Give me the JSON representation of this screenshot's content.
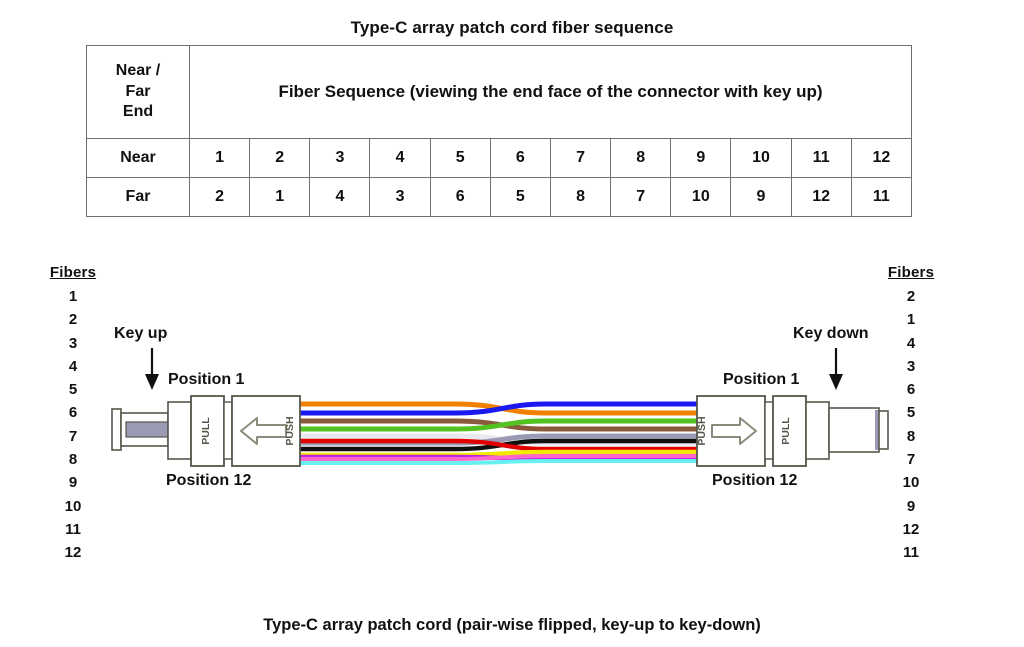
{
  "title": "Type-C array patch cord fiber sequence",
  "caption": "Type-C array patch cord (pair-wise flipped, key-up to key-down)",
  "table": {
    "header_end": "Near /\nFar\nEnd",
    "header_end_line1": "Near /",
    "header_end_line2": "Far",
    "header_end_line3": "End",
    "header_sequence": "Fiber Sequence (viewing the end face of the connector with key up)",
    "rows": [
      {
        "label": "Near",
        "values": [
          "1",
          "2",
          "3",
          "4",
          "5",
          "6",
          "7",
          "8",
          "9",
          "10",
          "11",
          "12"
        ]
      },
      {
        "label": "Far",
        "values": [
          "2",
          "1",
          "4",
          "3",
          "6",
          "5",
          "8",
          "7",
          "10",
          "9",
          "12",
          "11"
        ]
      }
    ]
  },
  "left_fibers": {
    "heading": "Fibers",
    "numbers": [
      "1",
      "2",
      "3",
      "4",
      "5",
      "6",
      "7",
      "8",
      "9",
      "10",
      "11",
      "12"
    ]
  },
  "right_fibers": {
    "heading": "Fibers",
    "numbers": [
      "2",
      "1",
      "4",
      "3",
      "6",
      "5",
      "8",
      "7",
      "10",
      "9",
      "12",
      "11"
    ]
  },
  "diagram": {
    "left_connector": {
      "key_label": "Key up",
      "position_first": "Position 1",
      "position_last": "Position 12",
      "pull_label": "PULL",
      "push_label": "PUSH",
      "arrow_direction": "left"
    },
    "right_connector": {
      "key_label": "Key down",
      "position_first": "Position 1",
      "position_last": "Position 12",
      "pull_label": "PULL",
      "push_label": "PUSH",
      "arrow_direction": "right"
    },
    "ribbon_colors_left": [
      "#1a1af0",
      "#f08000",
      "#52c122",
      "#8a5a3c",
      "#9a9ab4",
      "#e8e8ee",
      "#e00000",
      "#101010",
      "#f2e800",
      "#c020e8",
      "#ff66cc",
      "#66f0f0"
    ],
    "ribbon_colors_right": [
      "#f08000",
      "#1a1af0",
      "#8a5a3c",
      "#52c122",
      "#e8e8ee",
      "#9a9ab4",
      "#101010",
      "#e00000",
      "#c020e8",
      "#f2e800",
      "#66f0f0",
      "#ff66cc"
    ],
    "fiber_color_names": [
      "blue",
      "orange",
      "green",
      "brown",
      "slate",
      "white",
      "red",
      "black",
      "yellow",
      "violet",
      "rose",
      "aqua"
    ],
    "body_fill": "#ffffff",
    "body_stroke": "#55564a",
    "boot_band_fill": "#9a9ab4"
  }
}
